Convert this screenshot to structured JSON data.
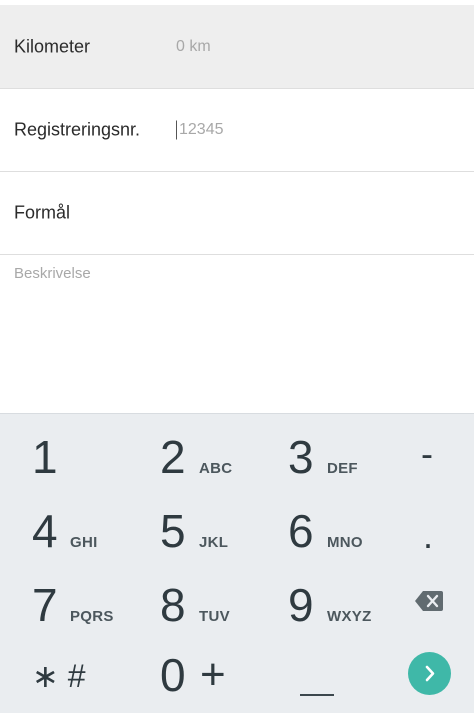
{
  "form": {
    "kilometer": {
      "label": "Kilometer",
      "value": "0 km"
    },
    "registration": {
      "label": "Registreringsnr.",
      "placeholder": "12345"
    },
    "purpose": {
      "label": "Formål"
    },
    "description": {
      "placeholder": "Beskrivelse"
    }
  },
  "keyboard": {
    "keys": [
      {
        "digit": "1",
        "letters": ""
      },
      {
        "digit": "2",
        "letters": "ABC"
      },
      {
        "digit": "3",
        "letters": "DEF"
      },
      {
        "digit": "4",
        "letters": "GHI"
      },
      {
        "digit": "5",
        "letters": "JKL"
      },
      {
        "digit": "6",
        "letters": "MNO"
      },
      {
        "digit": "7",
        "letters": "PQRS"
      },
      {
        "digit": "8",
        "letters": "TUV"
      },
      {
        "digit": "9",
        "letters": "WXYZ"
      },
      {
        "digit": "0",
        "letters": "+"
      }
    ],
    "symbols": {
      "dash": "-",
      "dot": ".",
      "star_hash": "∗ #"
    },
    "icons": {
      "backspace": "backspace-icon",
      "next": "chevron-right-icon"
    },
    "colors": {
      "background": "#eaedf0",
      "key_text": "#2f3a40",
      "accent": "#3fb8a8"
    }
  }
}
